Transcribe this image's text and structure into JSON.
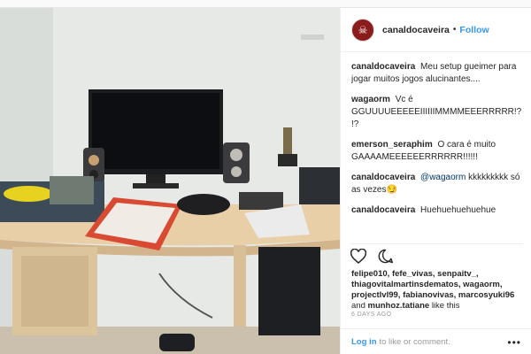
{
  "post": {
    "username": "canaldocaveira",
    "follow_label": "Follow",
    "separator": "•",
    "avatar_glyph": "☠",
    "caption": {
      "user": "canaldocaveira",
      "text": "Meu setup gueimer para jogar muitos jogos alucinantes...."
    },
    "comments": [
      {
        "user": "wagaorm",
        "text": "Vc é GGUUUUEEEEEIIIIIIMMMMEEERRRRR!?!?"
      },
      {
        "user": "emerson_seraphim",
        "text": "O cara é muito GAAAAMEEEEEERRRRRR!!!!!!"
      },
      {
        "user": "canaldocaveira",
        "mention": "@wagaorm",
        "text": " kkkkkkkkk só as vezes😏"
      },
      {
        "user": "canaldocaveira",
        "text": "Huehuehuehuehue"
      }
    ],
    "likes": {
      "names": "felipe010, fefe_vivas, senpaitv_, thiagovitalmartinsdematos, wagaorm, projectlvl99, fabianovivas, marcosyuki96",
      "and_text": "and",
      "last_name": "munhoz.tatiane",
      "tail": "like this"
    },
    "time_ago": "6 DAYS AGO",
    "footer": {
      "login": "Log in",
      "rest": "to like or comment.",
      "more": "•••"
    }
  },
  "colors": {
    "link": "#3897f0",
    "mention": "#003569",
    "muted": "#999999",
    "avatar": "#8a1c1c"
  },
  "icons": [
    "heart-icon",
    "comment-icon",
    "more-icon",
    "skull-avatar-icon"
  ]
}
